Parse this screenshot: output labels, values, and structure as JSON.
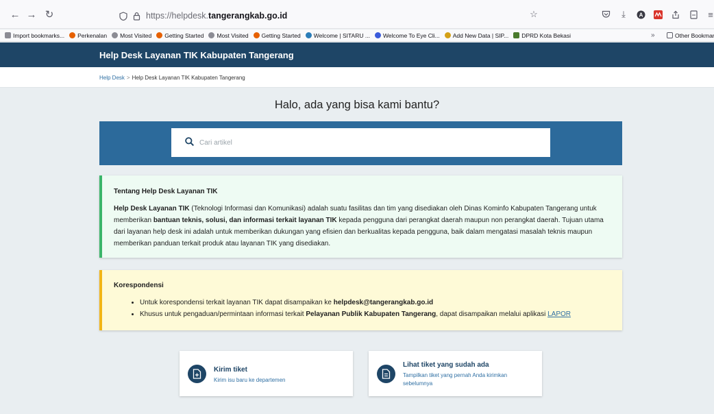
{
  "browser": {
    "url_prefix": "https://helpdesk.",
    "url_host": "tangerangkab.go.id",
    "bookmarks": [
      {
        "label": "Import bookmarks...",
        "color": "#6b6b73"
      },
      {
        "label": "Perkenalan",
        "color": "#e66000"
      },
      {
        "label": "Most Visited",
        "color": "#5b5b66"
      },
      {
        "label": "Getting Started",
        "color": "#e66000"
      },
      {
        "label": "Most Visited",
        "color": "#5b5b66"
      },
      {
        "label": "Getting Started",
        "color": "#e66000"
      },
      {
        "label": "Welcome | SITARU ...",
        "color": "#2a7db8"
      },
      {
        "label": "Welcome To Eye Cli...",
        "color": "#3b5bdb"
      },
      {
        "label": "Add New Data | SIP...",
        "color": "#d4a017"
      },
      {
        "label": "DPRD Kota Bekasi",
        "color": "#4a7a2c"
      }
    ],
    "other_bookmarks": "Other Bookmar"
  },
  "header": {
    "title": "Help Desk Layanan TIK Kabupaten Tangerang"
  },
  "breadcrumb": {
    "home": "Help Desk",
    "separator": ">",
    "current": "Help Desk Layanan TIK Kabupaten Tangerang"
  },
  "hero": {
    "title": "Halo, ada yang bisa kami bantu?"
  },
  "search": {
    "placeholder": "Cari artikel"
  },
  "about": {
    "title": "Tentang Help Desk Layanan TIK",
    "p_bold1": "Help Desk Layanan TIK",
    "p_text1": " (Teknologi Informasi dan Komunikasi) adalah suatu fasilitas dan tim yang disediakan oleh Dinas Kominfo Kabupaten Tangerang untuk memberikan ",
    "p_bold2": "bantuan teknis, solusi, dan informasi terkait layanan TIK",
    "p_text2": " kepada pengguna dari perangkat daerah maupun non perangkat daerah. Tujuan utama dari layanan help desk ini adalah untuk memberikan dukungan yang efisien dan berkualitas kepada pengguna, baik dalam mengatasi masalah teknis maupun memberikan panduan terkait produk atau layanan TIK yang disediakan."
  },
  "correspondence": {
    "title": "Korespondensi",
    "item1_text": "Untuk korespondensi terkait layanan TIK dapat disampaikan ke ",
    "item1_email": "helpdesk@tangerangkab.go.id",
    "item2_text": "Khusus untuk pengaduan/permintaan informasi terkait ",
    "item2_bold": "Pelayanan Publik Kabupaten Tangerang",
    "item2_text2": ", dapat disampaikan melalui aplikasi ",
    "item2_link": "LAPOR"
  },
  "actions": {
    "new_ticket": {
      "title": "Kirim tiket",
      "subtitle": "Kirim isu baru ke departemen"
    },
    "view_tickets": {
      "title": "Lihat tiket yang sudah ada",
      "subtitle": "Tampilkan tiket yang pernah Anda kirimkan sebelumnya"
    }
  }
}
